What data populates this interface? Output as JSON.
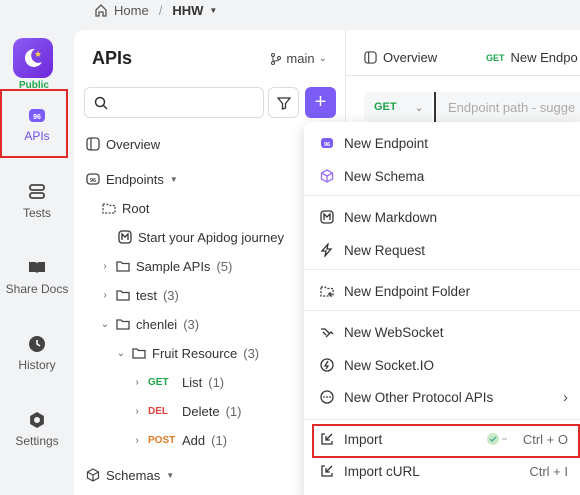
{
  "breadcrumb": {
    "home": "Home",
    "separator": "/",
    "project": "HHW"
  },
  "rail": {
    "badge": "Public",
    "items": [
      {
        "label": "APIs",
        "icon": "apis-icon"
      },
      {
        "label": "Tests",
        "icon": "tests-icon"
      },
      {
        "label": "Share Docs",
        "icon": "book-icon"
      },
      {
        "label": "History",
        "icon": "clock-icon"
      },
      {
        "label": "Settings",
        "icon": "gear-icon"
      }
    ]
  },
  "panel": {
    "title": "APIs",
    "branch": "main",
    "tree": {
      "overview": "Overview",
      "endpoints": "Endpoints",
      "root": "Root",
      "journey": "Start your Apidog journey",
      "sample": {
        "label": "Sample APIs",
        "count": "(5)"
      },
      "test": {
        "label": "test",
        "count": "(3)"
      },
      "chenlei": {
        "label": "chenlei",
        "count": "(3)"
      },
      "fruit": {
        "label": "Fruit Resource",
        "count": "(3)"
      },
      "endpoints_list": [
        {
          "method": "GET",
          "label": "List",
          "count": "(1)"
        },
        {
          "method": "DEL",
          "label": "Delete",
          "count": "(1)"
        },
        {
          "method": "POST",
          "label": "Add",
          "count": "(1)"
        }
      ],
      "schemas": "Schemas"
    }
  },
  "right": {
    "tab_overview": "Overview",
    "tab_new_method": "GET",
    "tab_new": "New Endpo",
    "method": "GET",
    "path_placeholder": "Endpoint path - sugge"
  },
  "menu": {
    "items": [
      {
        "label": "New Endpoint",
        "icon": "endpoint-icon"
      },
      {
        "label": "New Schema",
        "icon": "cube-icon"
      },
      {
        "label": "New Markdown",
        "icon": "markdown-icon"
      },
      {
        "label": "New Request",
        "icon": "bolt-icon"
      },
      {
        "label": "New Endpoint Folder",
        "icon": "folder-plus-icon"
      },
      {
        "label": "New WebSocket",
        "icon": "websocket-icon"
      },
      {
        "label": "New Socket.IO",
        "icon": "socketio-icon"
      },
      {
        "label": "New Other Protocol APIs",
        "icon": "more-icon"
      },
      {
        "label": "Import",
        "icon": "import-icon",
        "shortcut": "Ctrl + O"
      },
      {
        "label": "Import cURL",
        "icon": "terminal-icon",
        "shortcut": "Ctrl + I"
      }
    ]
  },
  "colors": {
    "accent": "#7b5cf6",
    "get": "#1ea64b",
    "delete": "#e0433f",
    "post": "#e07b27",
    "highlight": "#e02b2b"
  }
}
